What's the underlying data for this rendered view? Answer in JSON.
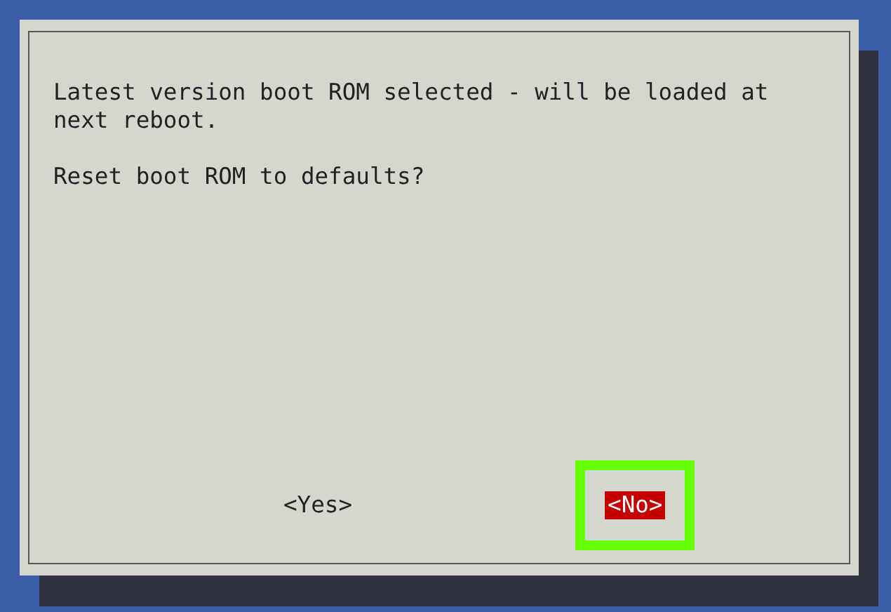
{
  "dialog": {
    "message": [
      "Latest version boot ROM selected - will be loaded at next reboot.",
      "Reset boot ROM to defaults?"
    ],
    "buttons": [
      {
        "label": "<Yes>",
        "selected": false,
        "highlighted": false
      },
      {
        "label": "<No>",
        "selected": true,
        "highlighted": true
      }
    ]
  }
}
